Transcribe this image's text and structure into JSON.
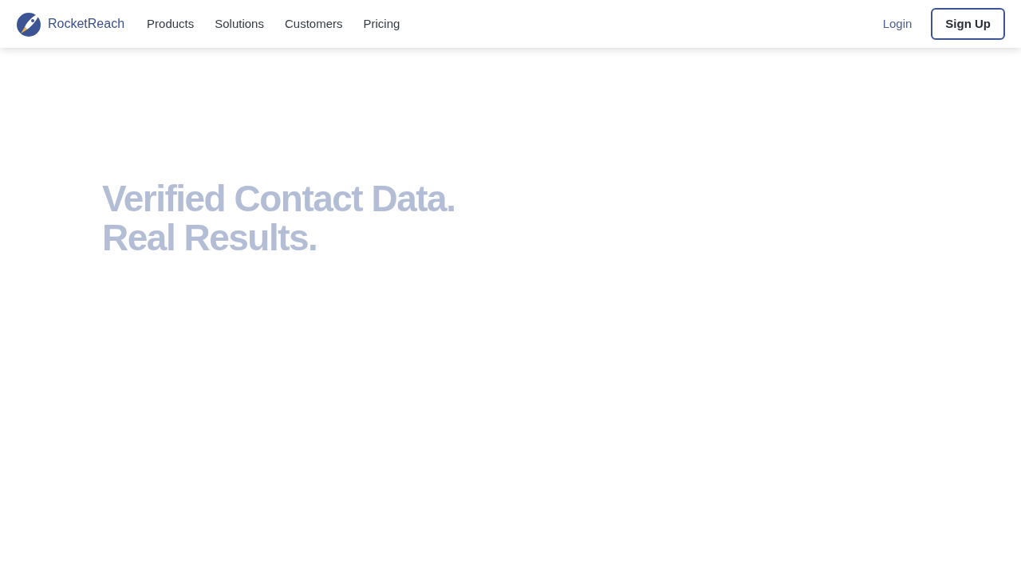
{
  "header": {
    "brand": "RocketReach",
    "nav": [
      {
        "label": "Products"
      },
      {
        "label": "Solutions"
      },
      {
        "label": "Customers"
      },
      {
        "label": "Pricing"
      }
    ],
    "login": "Login",
    "signup": "Sign Up"
  },
  "hero": {
    "lines": [
      "Verified Contact Data.",
      "Real Results."
    ]
  }
}
